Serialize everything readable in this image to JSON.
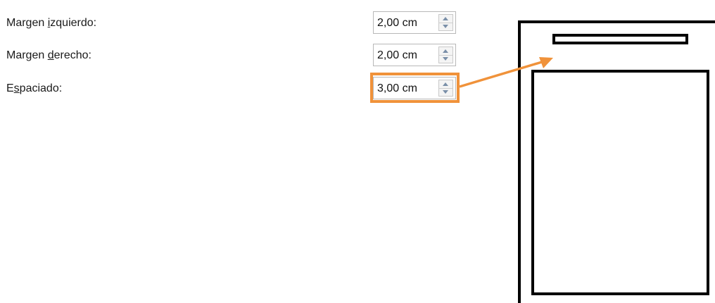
{
  "fields": [
    {
      "label_before": "Margen ",
      "label_underlined": "i",
      "label_after": "zquierdo:",
      "value": "2,00 cm"
    },
    {
      "label_before": "Margen ",
      "label_underlined": "d",
      "label_after": "erecho:",
      "value": "2,00 cm"
    },
    {
      "label_before": "E",
      "label_underlined": "s",
      "label_after": "paciado:",
      "value": "3,00 cm"
    }
  ],
  "colors": {
    "highlight": "#f0923a",
    "preview_stroke": "#000000"
  },
  "icons": {
    "spin_up": "chevron-up-icon",
    "spin_down": "chevron-down-icon",
    "annotation": "arrow-icon"
  }
}
